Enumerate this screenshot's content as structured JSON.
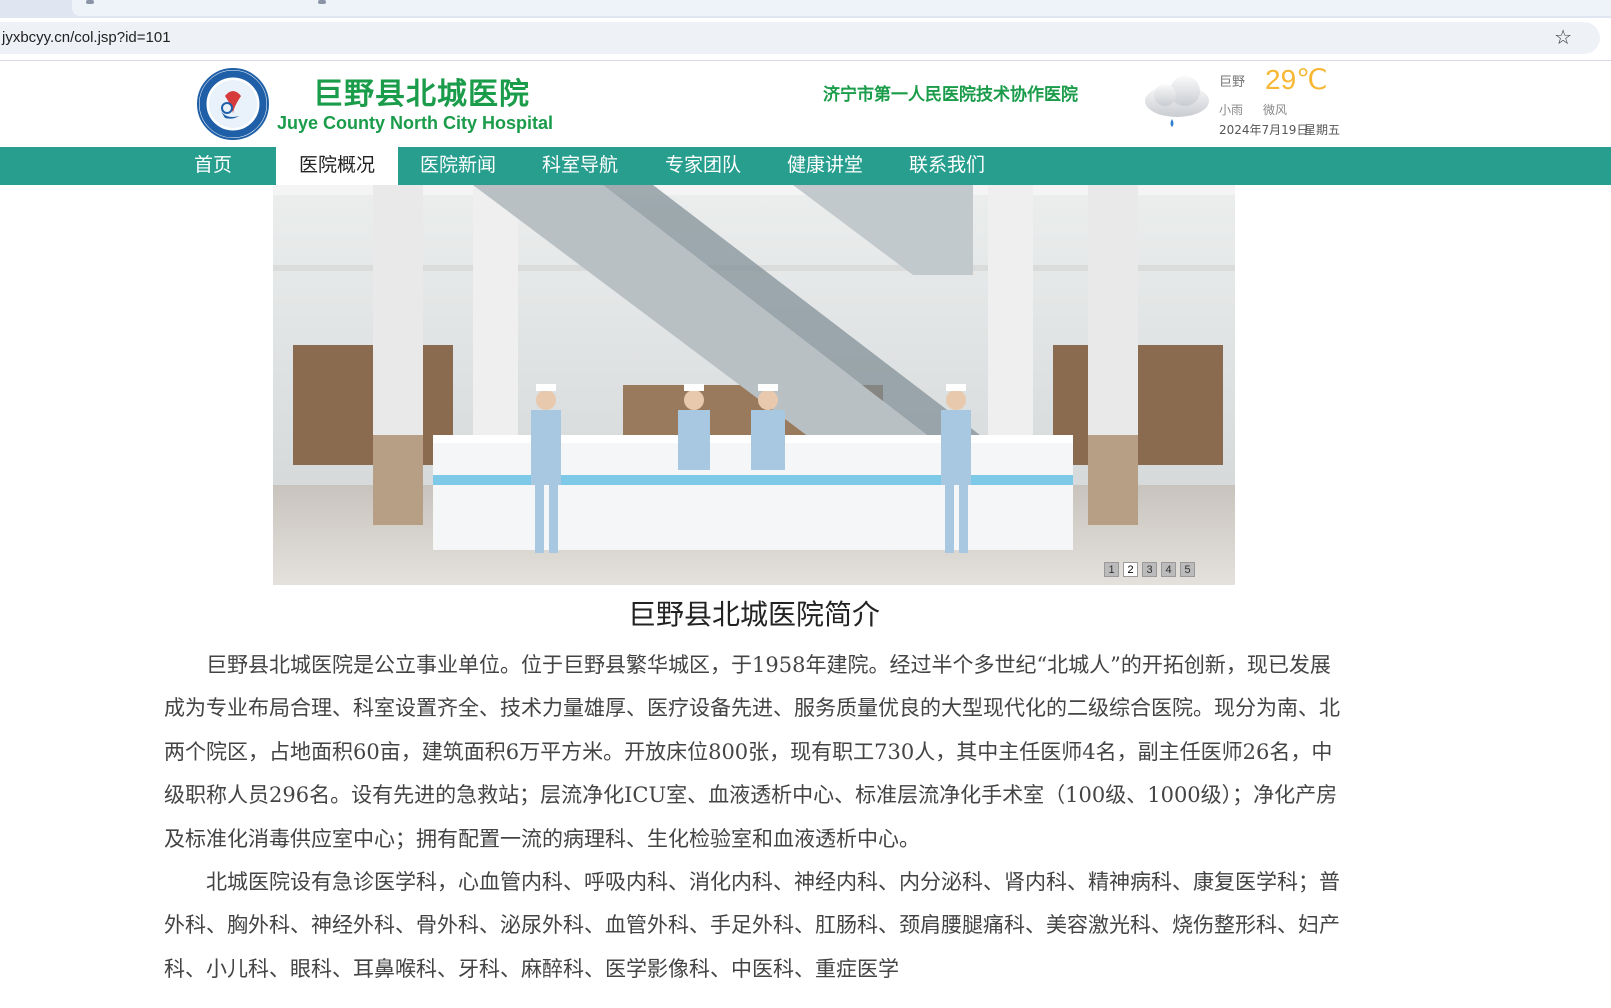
{
  "browser": {
    "url": "jyxbcyy.cn/col.jsp?id=101"
  },
  "header": {
    "title_cn": "巨野县北城医院",
    "title_en": "Juye County North City Hospital",
    "partner": "济宁市第一人民医院技术协作医院",
    "weather": {
      "city": "巨野",
      "temp": "29℃",
      "condition": "小雨",
      "wind": "微风",
      "date": "2024年7月19日",
      "weekday": "星期五",
      "icon": "cloud-rain-icon"
    }
  },
  "nav": {
    "items": [
      "首页",
      "医院概况",
      "医院新闻",
      "科室导航",
      "专家团队",
      "健康讲堂",
      "联系我们"
    ],
    "active_index": 1
  },
  "banner": {
    "pages": [
      "1",
      "2",
      "3",
      "4",
      "5"
    ],
    "active_page": "2"
  },
  "article": {
    "title": "巨野县北城医院简介",
    "paragraphs": [
      "巨野县北城医院是公立事业单位。位于巨野县繁华城区，于1958年建院。经过半个多世纪“北城人”的开拓创新，现已发展成为专业布局合理、科室设置齐全、技术力量雄厚、医疗设备先进、服务质量优良的大型现代化的二级综合医院。现分为南、北两个院区，占地面积60亩，建筑面积6万平方米。开放床位800张，现有职工730人，其中主任医师4名，副主任医师26名，中级职称人员296名。设有先进的急救站；层流净化ICU室、血液透析中心、标准层流净化手术室（100级、1000级）；净化产房及标准化消毒供应室中心；拥有配置一流的病理科、生化检验室和血液透析中心。",
      "北城医院设有急诊医学科，心血管内科、呼吸内科、消化内科、神经内科、内分泌科、肾内科、精神病科、康复医学科；普外科、胸外科、神经外科、骨外科、泌尿外科、血管外科、手足外科、肛肠科、颈肩腰腿痛科、美容激光科、烧伤整形科、妇产科、小儿科、眼科、耳鼻喉科、牙科、麻醉科、医学影像科、中医科、重症医学"
    ]
  },
  "colors": {
    "brand_green": "#1a9c4a",
    "nav_teal": "#279e8e",
    "temp_orange": "#f7b733"
  }
}
